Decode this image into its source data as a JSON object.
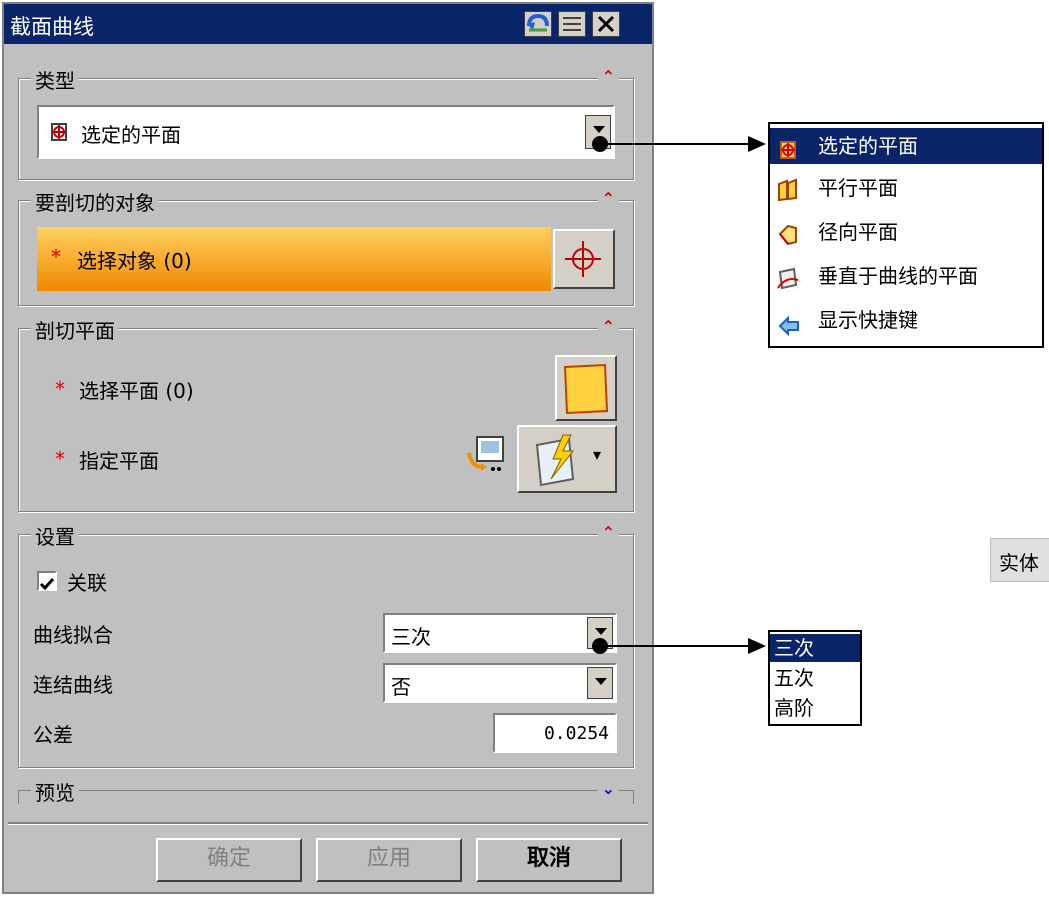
{
  "dialog": {
    "title": "截面曲线",
    "groups": {
      "type": {
        "label": "类型",
        "selected": "选定的平面"
      },
      "objects": {
        "label": "要剖切的对象",
        "select_label": "选择对象 (0)"
      },
      "plane": {
        "label": "剖切平面",
        "select_plane_label": "选择平面 (0)",
        "specify_plane_label": "指定平面"
      },
      "settings": {
        "label": "设置",
        "associative_label": "关联",
        "associative_checked": true,
        "curve_fit_label": "曲线拟合",
        "curve_fit_value": "三次",
        "join_curves_label": "连结曲线",
        "join_curves_value": "否",
        "tolerance_label": "公差",
        "tolerance_value": "0.0254"
      },
      "preview": {
        "label": "预览"
      }
    },
    "buttons": {
      "ok": "确定",
      "apply": "应用",
      "cancel": "取消"
    }
  },
  "type_popup": {
    "items": [
      {
        "label": "选定的平面",
        "icon": "selected-plane-icon",
        "selected": true
      },
      {
        "label": "平行平面",
        "icon": "parallel-planes-icon",
        "selected": false
      },
      {
        "label": "径向平面",
        "icon": "radial-planes-icon",
        "selected": false
      },
      {
        "label": "垂直于曲线的平面",
        "icon": "perpendicular-to-curve-icon",
        "selected": false
      },
      {
        "label": "显示快捷键",
        "icon": "show-shortcuts-icon",
        "selected": false
      }
    ]
  },
  "curve_fit_popup": {
    "items": [
      {
        "label": "三次",
        "selected": true
      },
      {
        "label": "五次",
        "selected": false
      },
      {
        "label": "高阶",
        "selected": false
      }
    ]
  },
  "right_fragment": {
    "label": "实体"
  },
  "colors": {
    "titlebar": "#0a246a",
    "selection": "#0a246a",
    "required_star": "#e00000",
    "active_select_gradient_top": "#ffd060",
    "active_select_gradient_bottom": "#f08800"
  }
}
